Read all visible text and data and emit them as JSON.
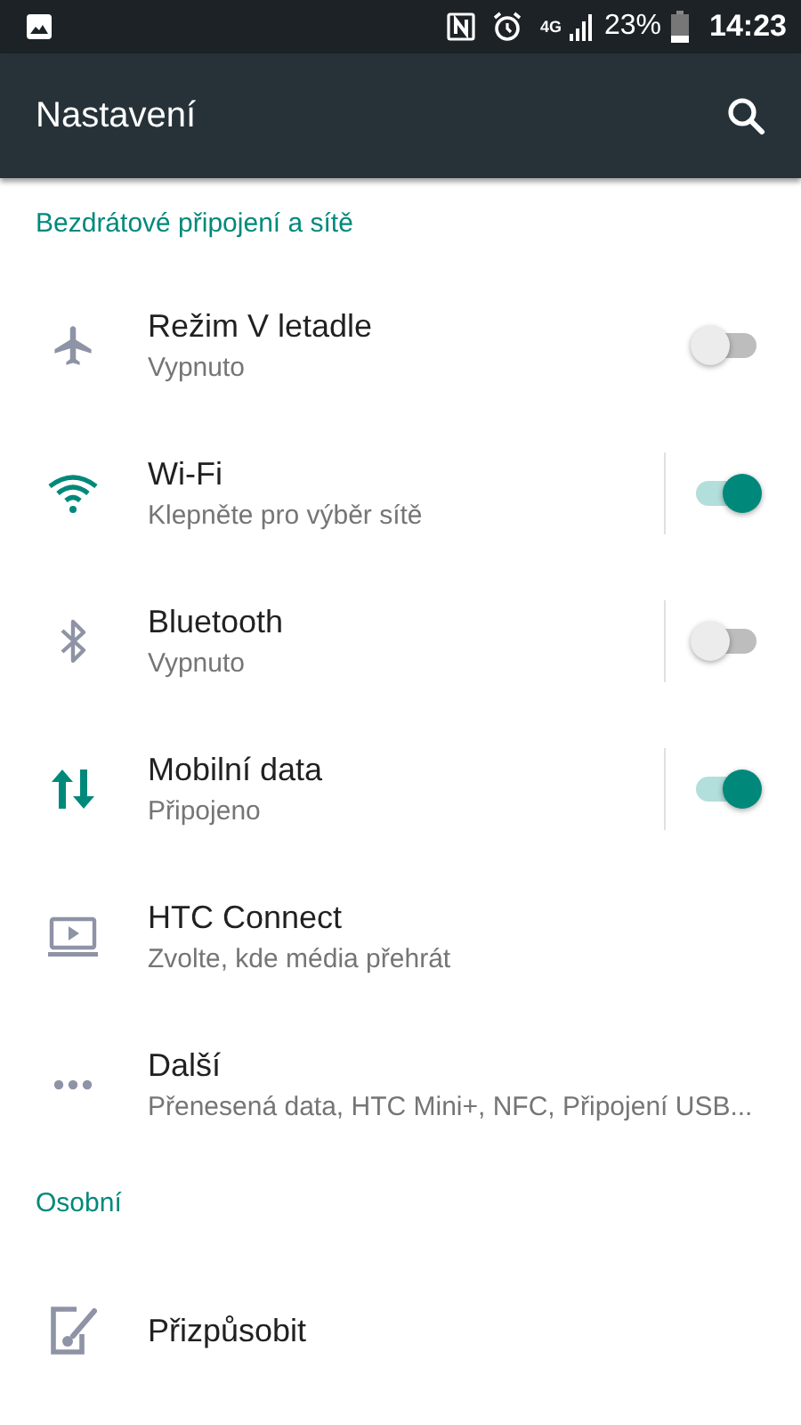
{
  "status_bar": {
    "network": "4G",
    "battery": "23%",
    "time": "14:23"
  },
  "app_bar": {
    "title": "Nastavení"
  },
  "sections": [
    {
      "header": "Bezdrátové připojení a sítě",
      "items": [
        {
          "kind": "toggle",
          "title": "Režim V letadle",
          "summary": "Vypnuto",
          "on": false
        },
        {
          "kind": "split-toggle",
          "title": "Wi-Fi",
          "summary": "Klepněte pro výběr sítě",
          "on": true
        },
        {
          "kind": "split-toggle",
          "title": "Bluetooth",
          "summary": "Vypnuto",
          "on": false
        },
        {
          "kind": "split-toggle",
          "title": "Mobilní data",
          "summary": "Připojeno",
          "on": true
        },
        {
          "kind": "plain",
          "title": "HTC Connect",
          "summary": "Zvolte, kde média přehrát"
        },
        {
          "kind": "plain",
          "title": "Další",
          "summary": "Přenesená data, HTC Mini+, NFC, Připojení USB..."
        }
      ]
    },
    {
      "header": "Osobní",
      "items": [
        {
          "kind": "plain",
          "title": "Přizpůsobit"
        }
      ]
    }
  ]
}
